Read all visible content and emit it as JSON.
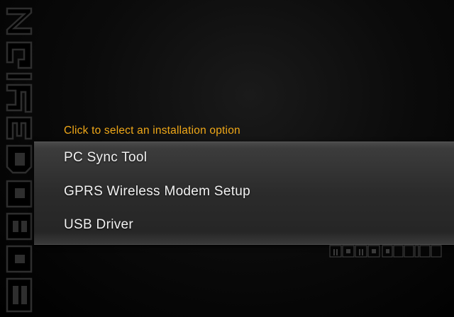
{
  "brand": {
    "vertical_logo": "MOMODESIGN",
    "horizontal_logo": "MOMODESIGN"
  },
  "installer": {
    "prompt": "Click to select an installation option",
    "options": [
      {
        "label": "PC Sync Tool"
      },
      {
        "label": "GPRS Wireless Modem Setup"
      },
      {
        "label": "USB Driver"
      }
    ]
  },
  "colors": {
    "prompt": "#f0a818",
    "menu_text": "#f2f2f2",
    "background": "#000000"
  }
}
